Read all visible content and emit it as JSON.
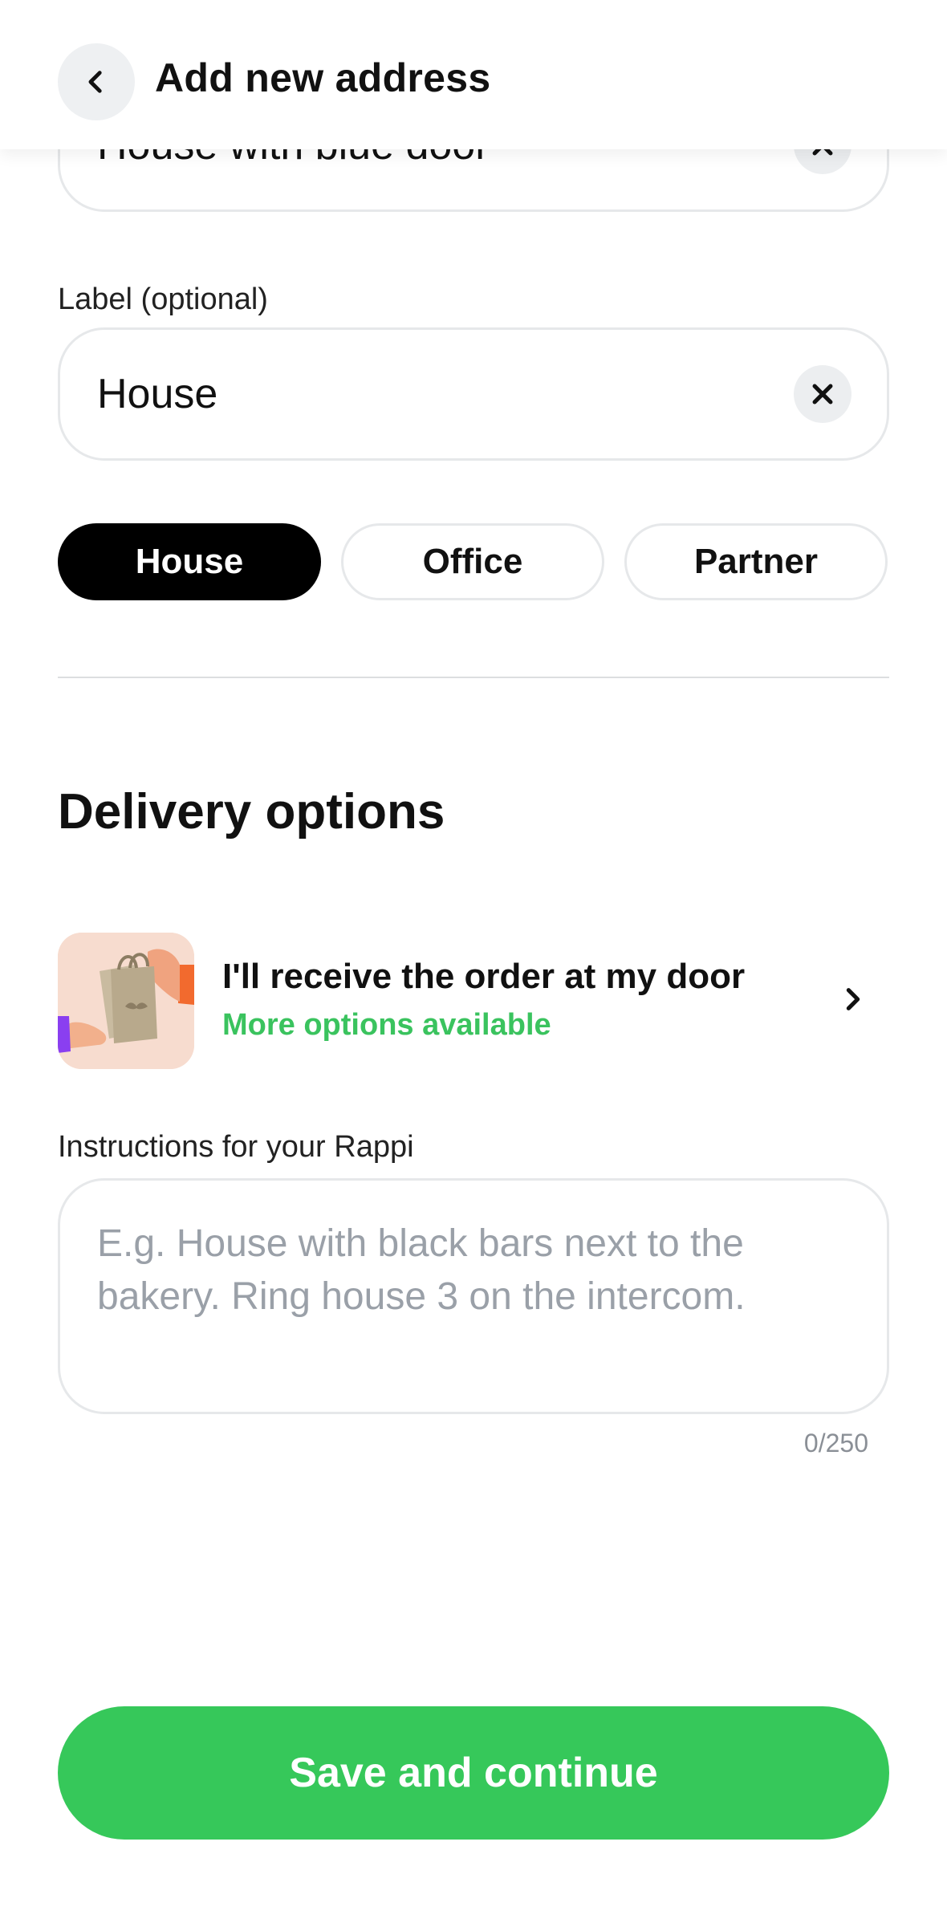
{
  "header": {
    "title": "Add new address",
    "back_icon": "chevron-left-icon"
  },
  "reference_field": {
    "value": "House with blue door"
  },
  "label_field": {
    "label": "Label (optional)",
    "value": "House"
  },
  "label_chips": [
    {
      "label": "House",
      "selected": true
    },
    {
      "label": "Office",
      "selected": false
    },
    {
      "label": "Partner",
      "selected": false
    }
  ],
  "delivery": {
    "section_title": "Delivery options",
    "option_title": "I'll receive the order at my door",
    "option_subtitle": "More options available",
    "option_icon": "hand-with-bag-illustration",
    "chevron_icon": "chevron-right-icon"
  },
  "instructions": {
    "label": "Instructions for your Rappi",
    "placeholder": "E.g. House with black bars next to the bakery. Ring house 3 on the intercom.",
    "counter": "0/250"
  },
  "footer": {
    "save_label": "Save and continue"
  },
  "colors": {
    "accent_green": "#36c85a",
    "subtitle_green": "#3ac35e",
    "chip_active": "#000000"
  }
}
